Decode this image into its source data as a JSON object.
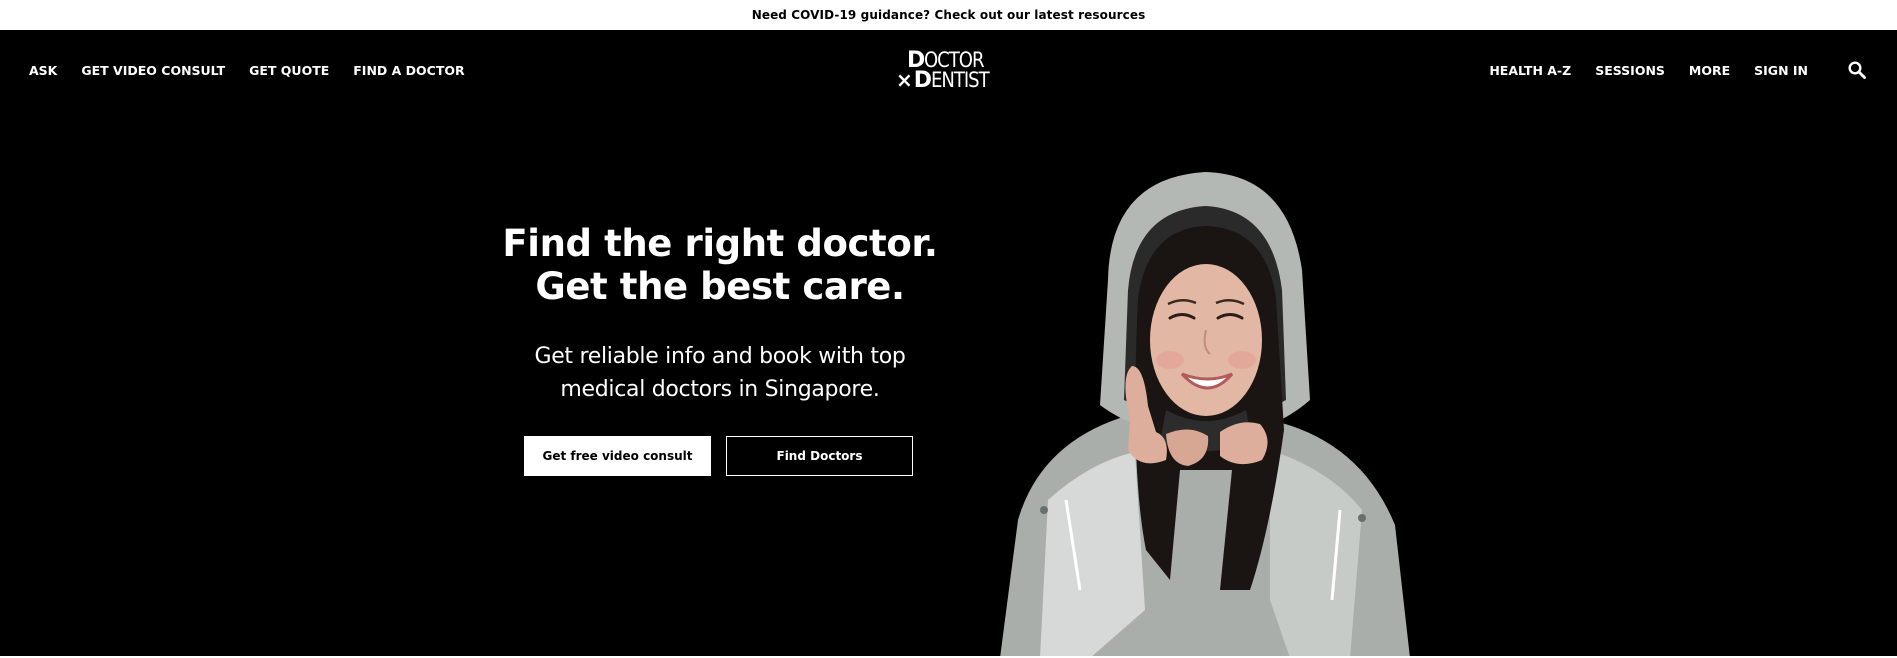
{
  "announcement": {
    "text": "Need COVID-19 guidance? Check out our latest resources"
  },
  "header": {
    "nav_left": [
      {
        "label": "ASK"
      },
      {
        "label": "GET VIDEO CONSULT"
      },
      {
        "label": "GET QUOTE"
      },
      {
        "label": "FIND A DOCTOR"
      }
    ],
    "logo": {
      "line1_initial": "D",
      "line1_rest": "OCTOR",
      "line2_x": "×",
      "line2_initial": "D",
      "line2_rest": "ENTIST"
    },
    "nav_right": [
      {
        "label": "HEALTH A-Z"
      },
      {
        "label": "SESSIONS"
      },
      {
        "label": "MORE"
      },
      {
        "label": "SIGN IN"
      }
    ],
    "search_icon": "search-icon"
  },
  "hero": {
    "headline_line1": "Find the right doctor.",
    "headline_line2": "Get the best care.",
    "subtext_line1": "Get reliable info and book with top",
    "subtext_line2": "medical doctors in Singapore.",
    "primary_button": "Get free video consult",
    "secondary_button": "Find Doctors"
  },
  "colors": {
    "background": "#000000",
    "text": "#ffffff",
    "announcement_bg": "#ffffff"
  }
}
